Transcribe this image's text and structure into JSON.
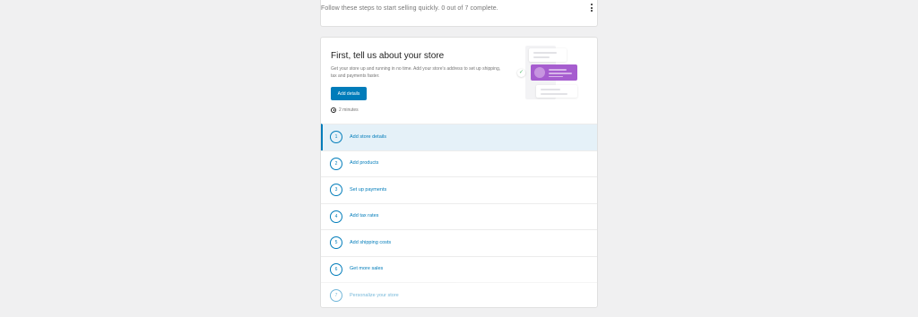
{
  "header": {
    "progress_text": "Follow these steps to start selling quickly. 0 out of 7 complete.",
    "menu_icon": "kebab-menu-icon"
  },
  "hero": {
    "title": "First, tell us about your store",
    "description": "Get your store up and running in no time. Add your store's address to set up shipping, tax and payments faster.",
    "button_label": "Add details",
    "time_estimate": "2 minutes",
    "time_icon": "clock-icon",
    "illustration_icon": "store-details-illustration",
    "colors": {
      "accent": "#007cba",
      "illustration_purple": "#a65dcf",
      "check_green": "#4ab866"
    }
  },
  "tasks": [
    {
      "number": "1",
      "label": "Add store details",
      "active": true
    },
    {
      "number": "2",
      "label": "Add products",
      "active": false
    },
    {
      "number": "3",
      "label": "Set up payments",
      "active": false
    },
    {
      "number": "4",
      "label": "Add tax rates",
      "active": false
    },
    {
      "number": "5",
      "label": "Add shipping costs",
      "active": false
    },
    {
      "number": "6",
      "label": "Get more sales",
      "active": false
    },
    {
      "number": "7",
      "label": "Personalize your store",
      "active": false
    }
  ]
}
